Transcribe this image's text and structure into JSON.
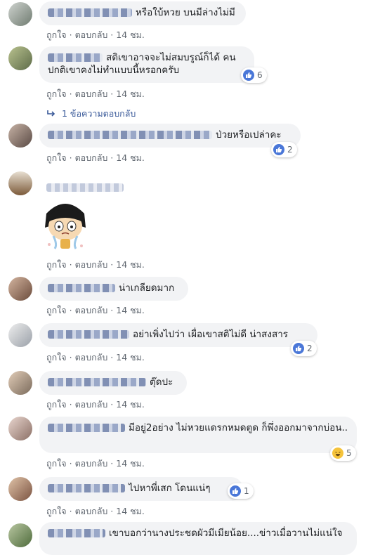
{
  "actions": {
    "like": "ถูกใจ",
    "reply": "ตอบกลับ",
    "time": "14 ชม."
  },
  "comments": [
    {
      "text": "หรือใบ้หวย บนมีล่างไม่มี"
    },
    {
      "text": "สติเขาอาจจะไม่สมบรูณ์ก็ได้ คนปกติเขาคงไม่ทำแบบนี้หรอกครับ",
      "reaction_count": "6",
      "replies_label": "1 ข้อความตอบกลับ"
    },
    {
      "text": "ป่วยหรือเปล่าคะ",
      "reaction_count": "2"
    },
    {
      "text": ""
    },
    {
      "text": "น่าเกลียดมาก"
    },
    {
      "text": "อย่าเพิ่งไปว่า เผื่อเขาสติไม่ดี น่าสงสาร",
      "reaction_count": "2"
    },
    {
      "text": "ตุ๊ดปะ"
    },
    {
      "text": "มีอยู่2อย่าง ไม่หวยแดรกหมดตูด ก็พึ่งออกมาจากบ่อน..",
      "reaction_count": "5"
    },
    {
      "text": "ไปหาพี่เสก โดนแน่ๆ",
      "reaction_count": "1"
    },
    {
      "text": "เขาบอกว่านางประชดผัวมีเมียน้อย....ข่าวเมื่อวานไม่แน่ใจ"
    }
  ],
  "icons": {
    "reply_arrow": "reply-arrow-icon",
    "like": "like-icon",
    "haha": "haha-icon"
  },
  "colors": {
    "bubble": "#f2f3f5",
    "link": "#385898",
    "meta": "#606770",
    "like_blue": "#4a77d8"
  }
}
